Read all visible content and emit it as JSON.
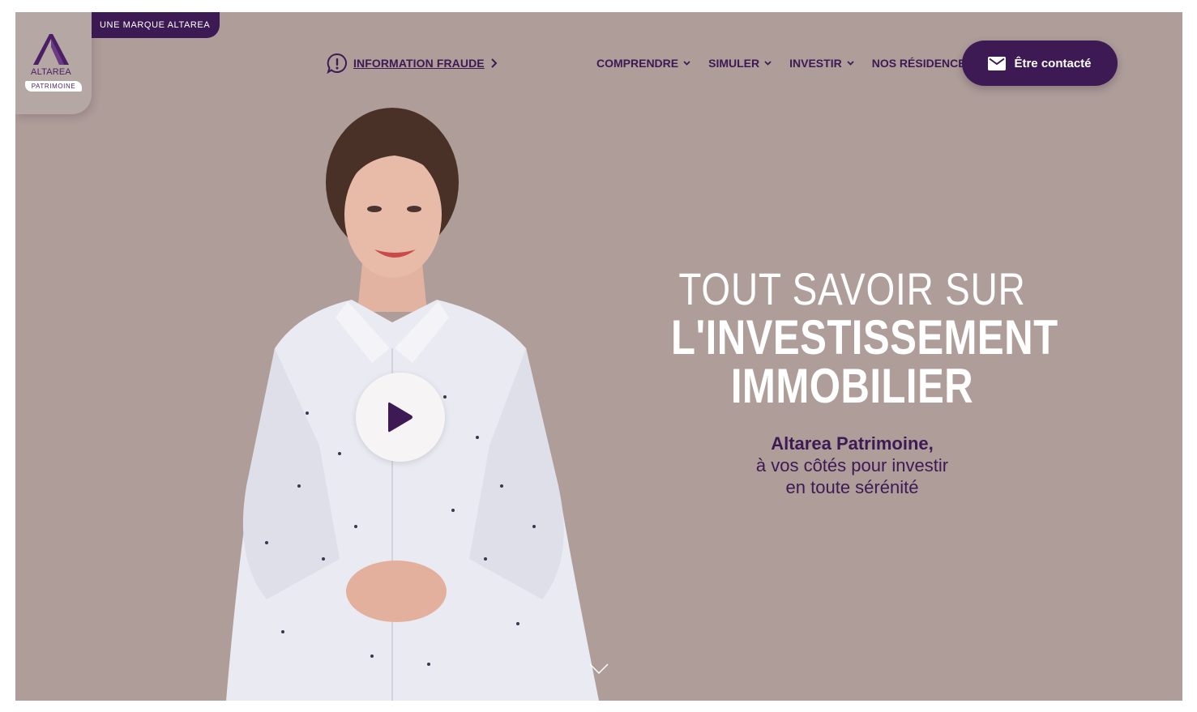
{
  "brand": {
    "tab_label": "UNE MARQUE ALTAREA",
    "logo_name": "ALTAREA",
    "logo_sub": "PATRIMOINE",
    "accent_color": "#3d1a54"
  },
  "header": {
    "fraud_link": {
      "icon": "alert-bubble-icon",
      "label": "INFORMATION FRAUDE"
    },
    "nav": [
      {
        "label": "COMPRENDRE",
        "has_dropdown": true
      },
      {
        "label": "SIMULER",
        "has_dropdown": true
      },
      {
        "label": "INVESTIR",
        "has_dropdown": true
      },
      {
        "label": "NOS RÉSIDENCES",
        "has_dropdown": false
      }
    ],
    "contact_button": {
      "icon": "mail-icon",
      "label": "Être contacté"
    }
  },
  "hero": {
    "background_color": "#ae9d99",
    "headline": {
      "line1": "TOUT SAVOIR SUR",
      "line2": "L'INVESTISSEMENT",
      "line3": "IMMOBILIER"
    },
    "subtitle": {
      "strong": "Altarea Patrimoine,",
      "line2": "à vos côtés pour investir",
      "line3": "en toute sérénité"
    },
    "video": {
      "play_icon": "play-icon"
    },
    "scroll_icon": "chevron-down-icon"
  }
}
